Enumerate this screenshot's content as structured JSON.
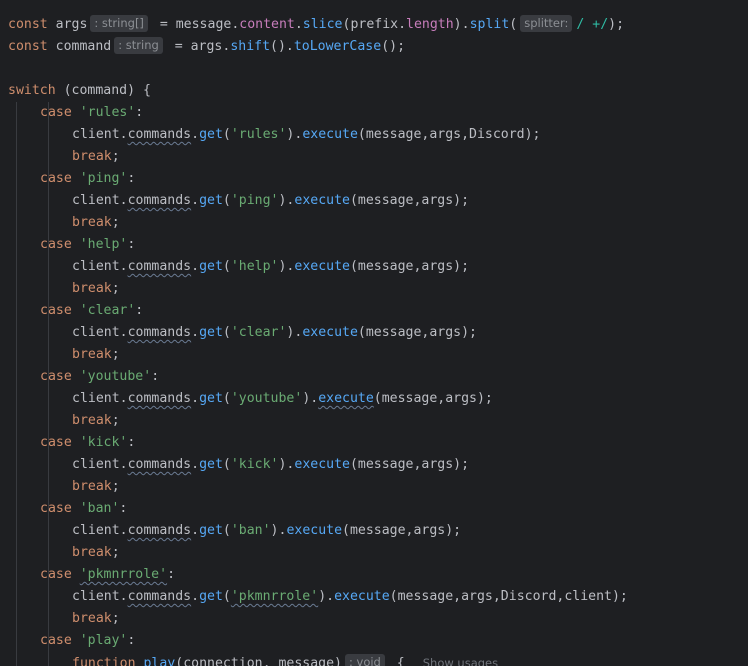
{
  "code": {
    "line1": {
      "kw": "const",
      "name": "args",
      "hint": ": string[]",
      "eq": " = message.",
      "content": "content",
      "dot1": ".",
      "slice": "slice",
      "open": "(prefix.",
      "length": "length",
      "close": ").",
      "split": "split",
      "paren": "(",
      "hint2": "splitter:",
      "regex": "/ +/",
      "end": ");"
    },
    "line2": {
      "kw": "const",
      "name": "command",
      "hint": ": string",
      "eq": " = args.",
      "shift": "shift",
      "mid": "().",
      "lower": "toLowerCase",
      "end": "();"
    },
    "switch_line": {
      "kw": "switch",
      "rest": " (command) {"
    },
    "cases": [
      {
        "label": "'rules'",
        "cmd": "'rules'",
        "args": "(message,args,Discord);",
        "execute_squig": false
      },
      {
        "label": "'ping'",
        "cmd": "'ping'",
        "args": "(message,args);",
        "execute_squig": false
      },
      {
        "label": "'help'",
        "cmd": "'help'",
        "args": "(message,args);",
        "execute_squig": false
      },
      {
        "label": "'clear'",
        "cmd": "'clear'",
        "args": "(message,args);",
        "execute_squig": false
      },
      {
        "label": "'youtube'",
        "cmd": "'youtube'",
        "args": "(message,args);",
        "execute_squig": true
      },
      {
        "label": "'kick'",
        "cmd": "'kick'",
        "args": "(message,args);",
        "execute_squig": false
      },
      {
        "label": "'ban'",
        "cmd": "'ban'",
        "args": "(message,args);",
        "execute_squig": false
      },
      {
        "label": "'pkmnrrole'",
        "cmd": "'pkmnrrole'",
        "args": "(message,args,Discord,client);",
        "execute_squig": false
      }
    ],
    "tokens": {
      "case": "case",
      "colon": ":",
      "client": "client.",
      "commands": "commands",
      "dot": ".",
      "get": "get",
      "paren_open": "(",
      "paren_close": ").",
      "execute": "execute",
      "break": "break",
      "semicolon": ";"
    },
    "play_case": {
      "label": "'play'"
    },
    "function_line": {
      "kw": "function",
      "name": "play",
      "params": "(connection, message)",
      "hint": ": void",
      "brace": "{",
      "usages": "Show usages"
    }
  }
}
